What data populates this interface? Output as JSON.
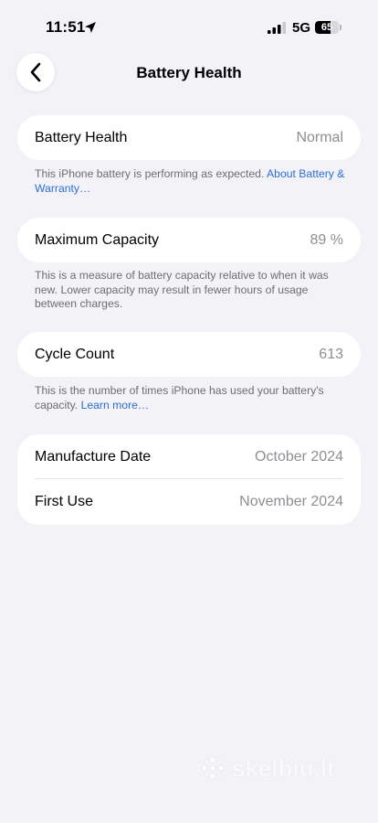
{
  "status_bar": {
    "time": "11:51",
    "network": "5G",
    "battery_level": "65",
    "battery_fraction": 0.65
  },
  "nav": {
    "title": "Battery Health",
    "back_icon": "chevron-left-icon"
  },
  "battery_health": {
    "label": "Battery Health",
    "value": "Normal",
    "note": "This iPhone battery is performing as expected.",
    "link": "About Battery & Warranty…"
  },
  "maximum_capacity": {
    "label": "Maximum Capacity",
    "value": "89 %",
    "note": "This is a measure of battery capacity relative to when it was new. Lower capacity may result in fewer hours of usage between charges."
  },
  "cycle_count": {
    "label": "Cycle Count",
    "value": "613",
    "note": "This is the number of times iPhone has used your battery's capacity.",
    "link": "Learn more…"
  },
  "dates": {
    "manufacture_label": "Manufacture Date",
    "manufacture_value": "October 2024",
    "first_use_label": "First Use",
    "first_use_value": "November 2024"
  },
  "watermark": {
    "text": "skelbiu.lt"
  },
  "colors": {
    "background": "#f2f2f7",
    "card": "#ffffff",
    "secondary_text": "#8e8e93",
    "footnote": "#6d6d72",
    "link": "#2c6fd6"
  }
}
